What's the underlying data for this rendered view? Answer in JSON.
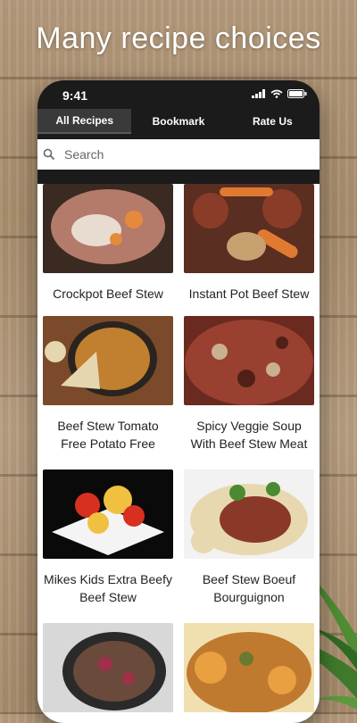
{
  "promo": {
    "headline": "Many recipe choices"
  },
  "status": {
    "time": "9:41"
  },
  "tabs": [
    {
      "label": "All Recipes",
      "active": true
    },
    {
      "label": "Bookmark",
      "active": false
    },
    {
      "label": "Rate Us",
      "active": false
    }
  ],
  "search": {
    "placeholder": "Search"
  },
  "recipes": [
    {
      "title": "Crockpot Beef Stew",
      "colors": [
        "#3a2a22",
        "#b47a6a",
        "#e8dcd0",
        "#e58a3a"
      ]
    },
    {
      "title": "Instant Pot Beef Stew",
      "colors": [
        "#5a2e20",
        "#8a3c28",
        "#e07a30",
        "#c9a070"
      ]
    },
    {
      "title": "Beef Stew Tomato Free Potato Free",
      "colors": [
        "#7a4a2a",
        "#c08030",
        "#e6d6b0",
        "#2a2420"
      ]
    },
    {
      "title": "Spicy Veggie Soup With Beef Stew Meat",
      "colors": [
        "#6a2a20",
        "#9a4030",
        "#c8b090",
        "#502018"
      ]
    },
    {
      "title": "Mikes Kids Extra Beefy Beef Stew",
      "colors": [
        "#0a0a0a",
        "#d83020",
        "#f0c040",
        "#f4f4f4"
      ]
    },
    {
      "title": "Beef Stew Boeuf Bourguignon",
      "colors": [
        "#f2f2f2",
        "#8a3828",
        "#4a8a30",
        "#e8d8b0"
      ]
    },
    {
      "title": "",
      "colors": [
        "#2a2a2a",
        "#a0304a",
        "#6a4a3a",
        "#d8d8d8"
      ]
    },
    {
      "title": "",
      "colors": [
        "#c07a30",
        "#e8a040",
        "#6a7a30",
        "#f0e0b0"
      ]
    }
  ]
}
